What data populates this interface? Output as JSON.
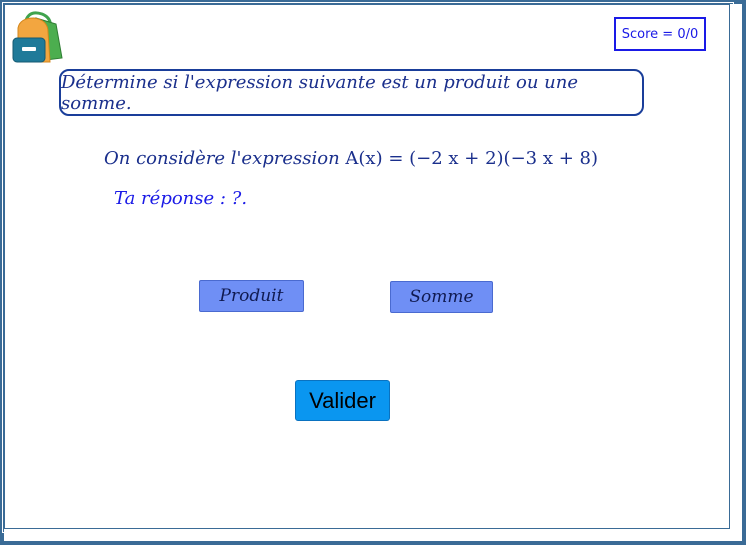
{
  "score": {
    "label": "Score = 0/0",
    "border_color": "#1a1ae6"
  },
  "instruction": {
    "text": "Détermine si l'expression suivante est un produit ou une somme."
  },
  "expression": {
    "prefix": "On considère l'expression ",
    "formula": "A(x) = (−2 x + 2)(−3 x + 8)"
  },
  "answer": {
    "text": "Ta réponse : ?."
  },
  "choices": {
    "produit_label": "Produit",
    "somme_label": "Somme",
    "color": "#6f8ff5"
  },
  "valider": {
    "label": "Valider",
    "color": "#0a96f0"
  },
  "icons": {
    "logo": "backpack-icon"
  },
  "colors": {
    "frame": "#3a6b96",
    "text_blue": "#1a2f8c"
  }
}
